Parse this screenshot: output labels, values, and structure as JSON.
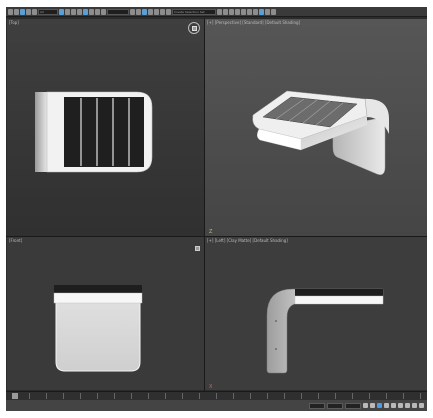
{
  "toolbar": {
    "buttons": [
      "undo-icon",
      "redo-icon",
      "link-icon",
      "unlink-icon",
      "bind-icon",
      "select-icon",
      "select-by-name-icon",
      "region-icon",
      "window-crossing-icon",
      "move-icon",
      "rotate-icon",
      "scale-icon",
      "place-icon"
    ],
    "selection_filter": "All",
    "named_selection": "Create Selection Set"
  },
  "viewports": {
    "top": {
      "label": "[Top]"
    },
    "perspective": {
      "label": "[+] [Perspective] [Standard] [Default Shading]"
    },
    "front": {
      "label": "[Front]"
    },
    "left": {
      "label": "[+] [Left] [Clay Matte] [Default Shading]"
    }
  },
  "axis": {
    "z": "Z",
    "x": "X"
  },
  "timeline": {
    "frame": "0 / 100"
  },
  "statusbar": {
    "text": ""
  },
  "colors": {
    "viewport_dark": "#363636",
    "viewport_perspective": "#505050",
    "model_white": "#f2f2f2",
    "panel_black": "#1e1e1e",
    "accent_blue": "#4d9be0"
  }
}
